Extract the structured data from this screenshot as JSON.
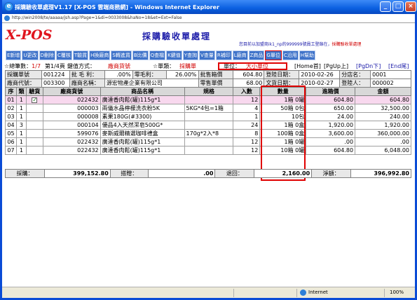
{
  "window": {
    "title": "採購驗收單處理V1.17 [X-POS 雲端商務網] - Windows Internet Explorer",
    "address": "http://win2008/te/aaaaa/jsh.asp?Page=1&di=0033008&haNo=18&et=Ext=False"
  },
  "app": {
    "logo": "X-POS",
    "page_title": "採購驗收單處理",
    "user_info_pre": "您目前以加盟商ik1_np的999999號員工登錄在，",
    "user_info_func": "採購驗收單處理"
  },
  "toolbar": [
    "E新增",
    "U更改",
    "D刪除",
    "C覆核",
    "T驗貨",
    "H換廠商",
    "S轉進貨",
    "B比價",
    "Q查檔",
    "K鍵值",
    "Y查詢",
    "V查量",
    "R補印",
    "L廠商",
    "Z商品",
    "G單位",
    "C沿用",
    "H幫助"
  ],
  "status": {
    "total_label": "☆總筆數：",
    "total_value": "1/7",
    "page": "第1/4頁",
    "key_label": "鍵值方式：",
    "key_value": "廠商貨號",
    "form_label": "☆單類：",
    "form_value": "採購單",
    "unit_label": "單位：",
    "unit_value": "大小單位",
    "nav": [
      "[Home首]",
      "[PgUp上]",
      "[PgDn下]",
      "[End尾]"
    ]
  },
  "info": {
    "po_no_label": "採購單號",
    "po_no": "001224",
    "batch_label": "批 毛 利：",
    "batch_margin": ".00%",
    "zero_margin_label": "零毛利：",
    "zero_margin": "26.00%",
    "batch_box_price_label": "批售箱價",
    "batch_box_price": "604.80",
    "reg_date_label": "登陸日期：",
    "reg_date": "2010-02-26",
    "store_label": "分店名：",
    "store": "0001",
    "vendor_code_label": "廠商代號：",
    "vendor_code": "003300",
    "vendor_name_label": "廠商名稱：",
    "vendor_name": "源宏物產企業有限公司",
    "retail_price_label": "零售單價",
    "retail_price": "68.00",
    "doc_date_label": "文貨日期：",
    "doc_date": "2010-02-27",
    "login_label": "登陸人：",
    "login": "000002"
  },
  "grid": {
    "columns": [
      "序",
      "類",
      "驗貨",
      "廠商貨號",
      "商品名稱",
      "規格",
      "入數",
      "數量",
      "進箱價",
      "金額"
    ],
    "rows": [
      {
        "seq": "01",
        "type": "1",
        "checked": true,
        "code": "022432",
        "name": "廣達香肉鬆(罐)115g*1",
        "spec": "",
        "pack": "12",
        "qty": "1箱  0罐",
        "price": "604.80",
        "amount": "604.80"
      },
      {
        "seq": "02",
        "type": "1",
        "checked": false,
        "code": "000003",
        "name": "兩儀水晶檸檬洗衣粉5K",
        "spec": "5KG*4包=1箱",
        "pack": "4",
        "qty": "50箱  0包",
        "price": "650.00",
        "amount": "32,500.00"
      },
      {
        "seq": "03",
        "type": "1",
        "checked": false,
        "code": "000008",
        "name": "素果180G(#3300)",
        "spec": "",
        "pack": "1",
        "qty": "10包",
        "price": "24.00",
        "amount": "240.00"
      },
      {
        "seq": "04",
        "type": "3",
        "checked": false,
        "code": "000104",
        "name": "優品4入天然潔皂500G*",
        "spec": "",
        "pack": "24",
        "qty": "1箱  0盒",
        "price": "1,920.00",
        "amount": "1,920.00"
      },
      {
        "seq": "05",
        "type": "1",
        "checked": false,
        "code": "599076",
        "name": "麥斯威爾精選咖啡禮盒",
        "spec": "170g*2入*8",
        "pack": "8",
        "qty": "100箱  0盒",
        "price": "3,600.00",
        "amount": "360,000.00"
      },
      {
        "seq": "06",
        "type": "1",
        "checked": false,
        "code": "022432",
        "name": "廣達香肉鬆(罐)115g*1",
        "spec": "",
        "pack": "12",
        "qty": "1箱  0罐",
        "price": ".00",
        "amount": ".00"
      },
      {
        "seq": "07",
        "type": "1",
        "checked": false,
        "code": "022432",
        "name": "廣達香肉鬆(罐)115g*1",
        "spec": "",
        "pack": "12",
        "qty": "10箱  0罐",
        "price": "604.80",
        "amount": "6,048.00"
      }
    ]
  },
  "footer": {
    "purchase_label": "採購：",
    "purchase": "399,152.80",
    "discount_label": "搭贈：",
    "discount": ".00",
    "return_label": "退回：",
    "return": "2,160.00",
    "net_label": "淨額：",
    "net": "396,992.80"
  },
  "statusbar": {
    "zone": "Internet",
    "zoom": "100%"
  }
}
